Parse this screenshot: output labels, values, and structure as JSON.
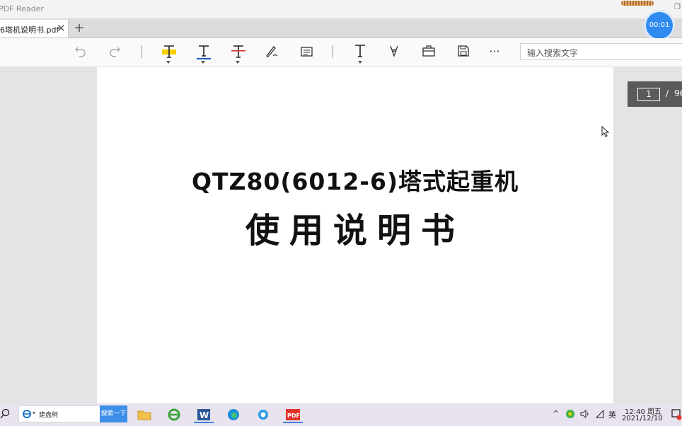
{
  "app": {
    "title": "PDF Reader",
    "timer": "00:01"
  },
  "tabs": [
    {
      "title": "6塔机说明书.pdf",
      "close": "✕"
    }
  ],
  "tab_add": "+",
  "toolbar": {
    "search_placeholder": "输入搜索文字",
    "more": "···",
    "highlight_color": "#f7d000",
    "underline_color": "#1e5bb5",
    "strike_color": "#d03030"
  },
  "document": {
    "line1": "QTZ80(6012-6)塔式起重机",
    "line2": "使用说明书"
  },
  "pager": {
    "current": "1",
    "separator": "/",
    "total": "96"
  },
  "taskbar": {
    "ie_search_text": "建盘舸",
    "ie_search_button": "搜索一下",
    "ime": "英",
    "time": "12:40 周五",
    "date": "2021/12/10"
  }
}
